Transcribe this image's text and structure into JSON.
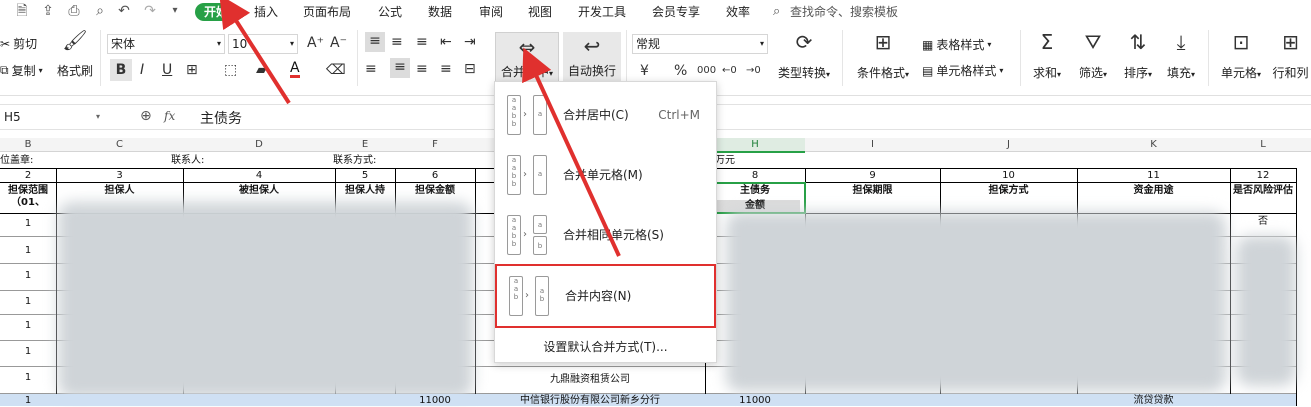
{
  "quick_access": [
    "save-icon",
    "export-icon",
    "print-icon",
    "preview-icon",
    "undo-icon",
    "redo-icon",
    "more-icon"
  ],
  "tabs": [
    "开始",
    "插入",
    "页面布局",
    "公式",
    "数据",
    "审阅",
    "视图",
    "开发工具",
    "会员专享",
    "效率"
  ],
  "search": {
    "label": "查找命令、搜索模板"
  },
  "ribbon": {
    "cut": "剪切",
    "copy": "复制",
    "format_painter": "格式刷",
    "font_name": "宋体",
    "font_size": "10",
    "merge_center": "合并居中",
    "wrap_text": "自动换行",
    "number_format": "常规",
    "type_convert": "类型转换",
    "cond_format": "条件格式",
    "table_style": "表格样式",
    "cell_style": "单元格样式",
    "sum": "求和",
    "filter": "筛选",
    "sort": "排序",
    "fill": "填充",
    "cell": "单元格",
    "row_col": "行和列",
    "bold": "B",
    "italic": "I",
    "underline": "U",
    "font_color": "A",
    "currency": "¥",
    "percent": "%",
    "thousands": "000"
  },
  "formula_bar": {
    "cell_ref": "H5",
    "fx": "fx",
    "value": "主债务"
  },
  "columns": [
    "B",
    "C",
    "D",
    "E",
    "F",
    "G",
    "H",
    "I",
    "J",
    "K",
    "L"
  ],
  "sheet": {
    "row1": {
      "c1": "位盖章:",
      "c2": "联系人:",
      "c3": "联系方式:",
      "c4": "万元"
    },
    "col_numbers": [
      "2",
      "3",
      "4",
      "5",
      "6",
      "7",
      "8",
      "9",
      "10",
      "11",
      "12"
    ],
    "headers": {
      "b": "担保范围（01、",
      "c": "担保人",
      "d": "被担保人",
      "e": "担保人持",
      "f": "担保金额",
      "h": "主债务",
      "h2": "金额",
      "i": "担保期限",
      "j": "担保方式",
      "k": "资金用途",
      "l": "是否风险评估"
    },
    "row_nums": [
      "1",
      "1",
      "1",
      "1",
      "1",
      "1",
      "1",
      "1"
    ],
    "bottom1": {
      "g": "九鼎融资租赁公司"
    },
    "bottom2": {
      "b": "1",
      "f": "11000",
      "g": "中信银行股份有限公司新乡分行",
      "h": "11000",
      "k": "流贷贷款"
    },
    "l_top": "否"
  },
  "menu": {
    "items": [
      {
        "label": "合并居中(C)",
        "shortcut": "Ctrl+M"
      },
      {
        "label": "合并单元格(M)",
        "shortcut": ""
      },
      {
        "label": "合并相同单元格(S)",
        "shortcut": ""
      },
      {
        "label": "合并内容(N)",
        "shortcut": ""
      }
    ],
    "footer": "设置默认合并方式(T)..."
  },
  "accent": "#27a046",
  "highlight": "#e0302e"
}
